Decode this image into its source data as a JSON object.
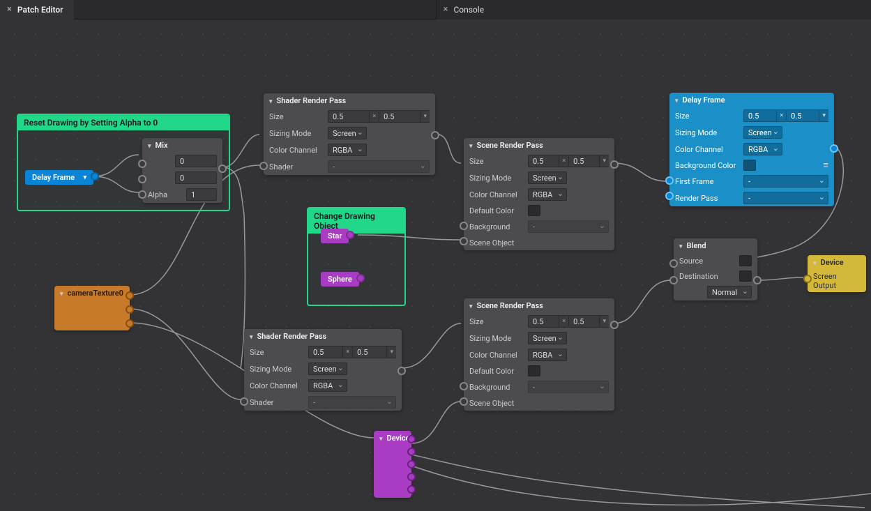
{
  "tabs": {
    "editor": "Patch Editor",
    "console": "Console"
  },
  "group1": {
    "title": "Reset Drawing by Setting Alpha to 0"
  },
  "group2": {
    "title": "Change Drawing Object"
  },
  "delayFramePill": "Delay Frame",
  "mix": {
    "title": "Mix",
    "v1": "0",
    "v2": "0",
    "alphaLbl": "Alpha",
    "alpha": "1"
  },
  "cameraTexture": "cameraTexture0",
  "star": "Star",
  "sphere": "Sphere",
  "labels": {
    "size": "Size",
    "sizingMode": "Sizing Mode",
    "colorChannel": "Color Channel",
    "shader": "Shader",
    "defaultColor": "Default Color",
    "background": "Background",
    "sceneObject": "Scene Object",
    "bgColor": "Background Color",
    "firstFrame": "First Frame",
    "renderPass": "Render Pass",
    "source": "Source",
    "destination": "Destination",
    "screenOutput": "Screen Output"
  },
  "options": {
    "screen": "Screen",
    "rgba": "RGBA",
    "normal": "Normal",
    "dash": "-"
  },
  "shaderRP1": {
    "title": "Shader Render Pass",
    "size1": "0.5",
    "size2": "0.5"
  },
  "shaderRP2": {
    "title": "Shader Render Pass",
    "size1": "0.5",
    "size2": "0.5"
  },
  "sceneRP1": {
    "title": "Scene Render Pass",
    "size1": "0.5",
    "size2": "0.5"
  },
  "sceneRP2": {
    "title": "Scene Render Pass",
    "size1": "0.5",
    "size2": "0.5"
  },
  "delayFrame": {
    "title": "Delay Frame",
    "size1": "0.5",
    "size2": "0.5"
  },
  "blend": {
    "title": "Blend"
  },
  "device": {
    "title": "Device"
  },
  "devicePurple": {
    "title": "Device"
  }
}
